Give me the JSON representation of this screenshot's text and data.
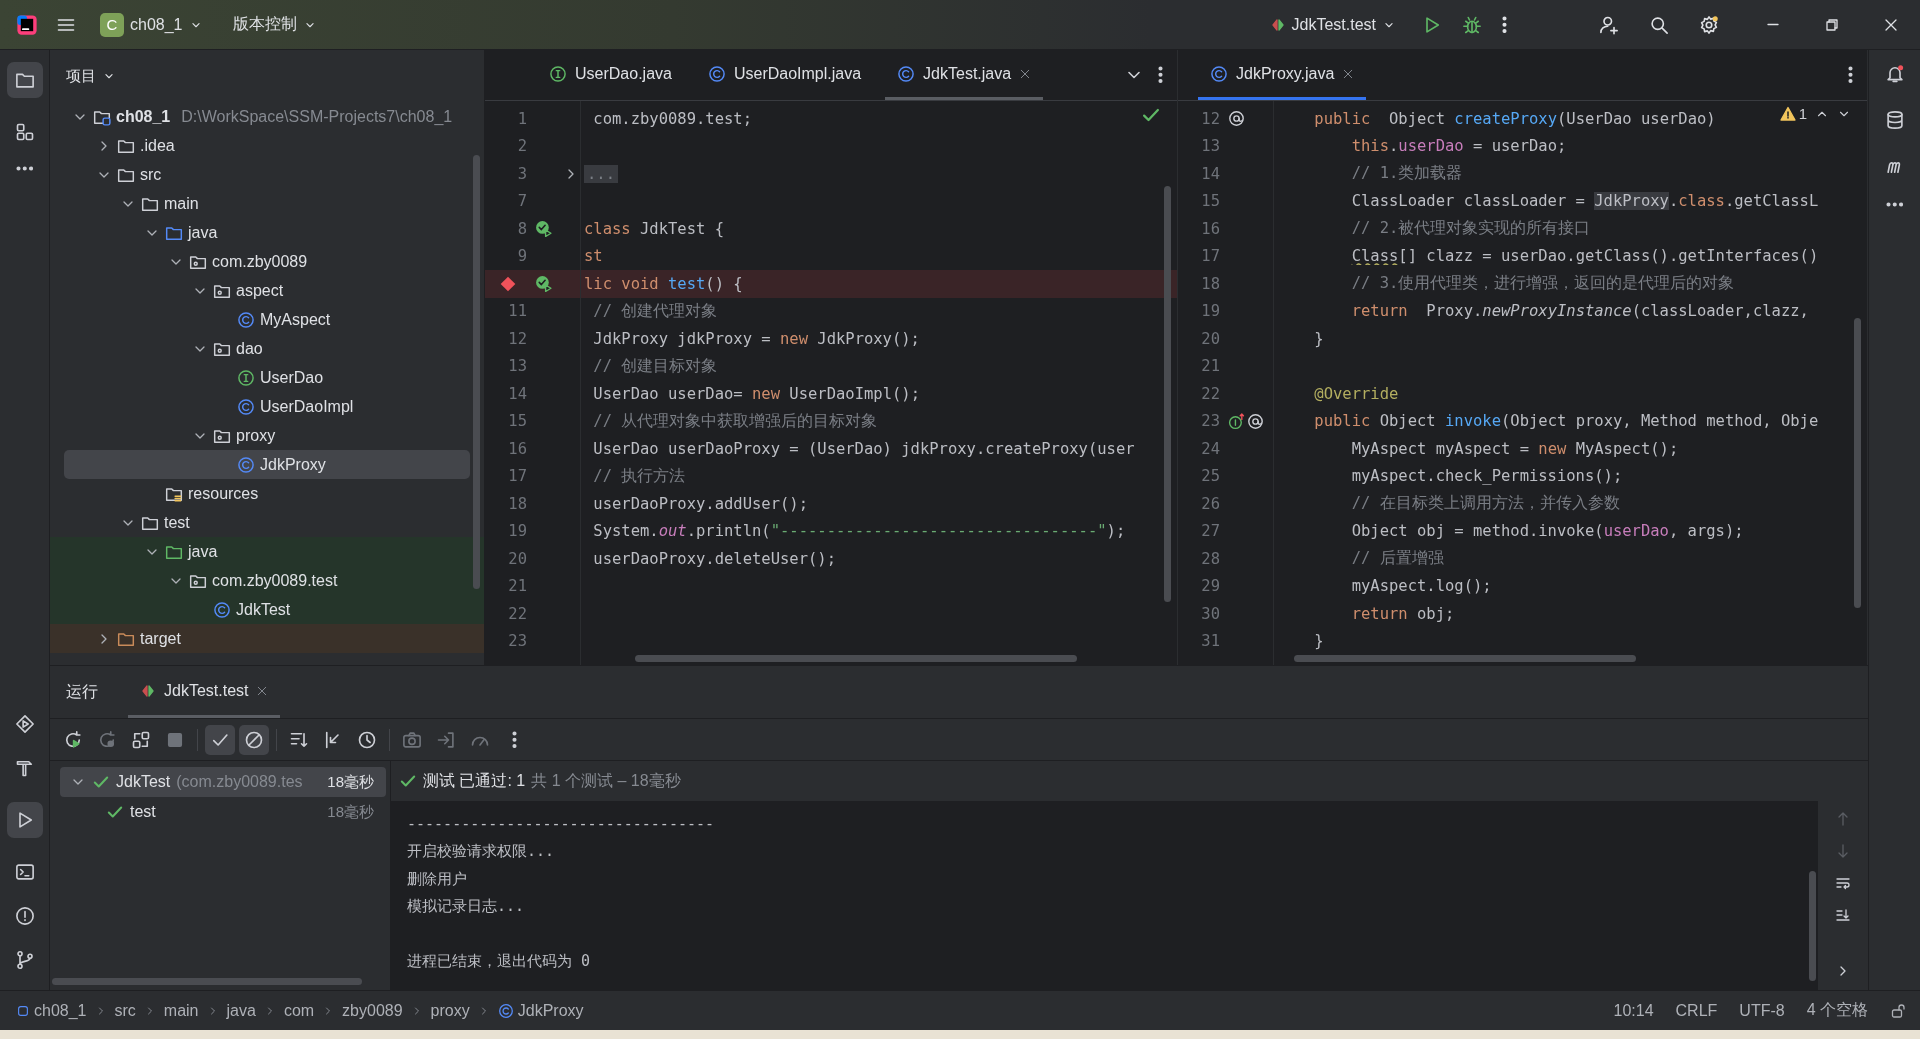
{
  "title_bar": {
    "project_badge": "C",
    "project": "ch08_1",
    "vcs": "版本控制",
    "run_config": "JdkTest.test"
  },
  "project_panel": {
    "title": "项目",
    "tree": [
      {
        "label": "ch08_1",
        "kind": "module",
        "path": "D:\\WorkSpace\\SSM-Projects7\\ch08_1",
        "expanded": true,
        "selected": false,
        "children": [
          {
            "label": ".idea",
            "kind": "folder",
            "expanded": false,
            "selected": false
          },
          {
            "label": "src",
            "kind": "folder",
            "expanded": true,
            "selected": false,
            "children": [
              {
                "label": "main",
                "kind": "folder",
                "expanded": true,
                "selected": false,
                "children": [
                  {
                    "label": "java",
                    "kind": "source-folder",
                    "expanded": true,
                    "selected": false,
                    "children": [
                      {
                        "label": "com.zby0089",
                        "kind": "package",
                        "expanded": true,
                        "selected": false,
                        "children": [
                          {
                            "label": "aspect",
                            "kind": "package",
                            "expanded": true,
                            "selected": false,
                            "children": [
                              {
                                "label": "MyAspect",
                                "kind": "class",
                                "selected": false
                              }
                            ]
                          },
                          {
                            "label": "dao",
                            "kind": "package",
                            "expanded": true,
                            "selected": false,
                            "children": [
                              {
                                "label": "UserDao",
                                "kind": "interface",
                                "selected": false
                              },
                              {
                                "label": "UserDaoImpl",
                                "kind": "class",
                                "selected": false
                              }
                            ]
                          },
                          {
                            "label": "proxy",
                            "kind": "package",
                            "expanded": true,
                            "selected": false,
                            "children": [
                              {
                                "label": "JdkProxy",
                                "kind": "class",
                                "selected": true
                              }
                            ]
                          }
                        ]
                      }
                    ]
                  },
                  {
                    "label": "resources",
                    "kind": "resources",
                    "selected": false
                  }
                ]
              },
              {
                "label": "test",
                "kind": "folder",
                "expanded": true,
                "selected": false,
                "children": [
                  {
                    "label": "java",
                    "kind": "test-folder",
                    "test_scope": true,
                    "expanded": true,
                    "selected": false,
                    "children": [
                      {
                        "label": "com.zby0089.test",
                        "kind": "package",
                        "test_scope": true,
                        "expanded": true,
                        "selected": false,
                        "children": [
                          {
                            "label": "JdkTest",
                            "kind": "class",
                            "test_scope": true,
                            "selected": false
                          }
                        ]
                      }
                    ]
                  }
                ]
              }
            ]
          },
          {
            "label": "target",
            "kind": "excluded-folder",
            "excluded": true,
            "expanded": false,
            "selected": false
          }
        ]
      }
    ]
  },
  "editors": [
    {
      "focused": false,
      "inspection": {
        "kind": "ok"
      },
      "tabs": [
        {
          "label": "UserDao.java",
          "kind": "interface",
          "selected": false
        },
        {
          "label": "UserDaoImpl.java",
          "kind": "class",
          "selected": false
        },
        {
          "label": "JdkTest.java",
          "kind": "class",
          "selected": true,
          "closable": true
        }
      ],
      "lines": [
        {
          "number": "1",
          "tokens": [
            {
              "kind": "plain",
              "text": " com.zby0089.test;"
            }
          ]
        },
        {
          "number": "2"
        },
        {
          "number": "3",
          "folded": true,
          "tokens": [
            {
              "kind": "fold",
              "text": "..."
            }
          ]
        },
        {
          "number": "7"
        },
        {
          "number": "8",
          "run_marker": true,
          "tokens": [
            {
              "kind": "keyword",
              "text": "class"
            },
            {
              "kind": "plain",
              "text": " JdkTest {"
            }
          ]
        },
        {
          "number": "9",
          "tokens": [
            {
              "kind": "keyword",
              "text": "st"
            }
          ]
        },
        {
          "breakpoint": true,
          "run_marker": true,
          "tokens": [
            {
              "kind": "keyword",
              "text": "lic void "
            },
            {
              "kind": "method",
              "text": "test"
            },
            {
              "kind": "plain",
              "text": "() {"
            }
          ]
        },
        {
          "number": "11",
          "tokens": [
            {
              "kind": "comment",
              "text": " // 创建代理对象"
            }
          ]
        },
        {
          "number": "12",
          "tokens": [
            {
              "kind": "plain",
              "text": " JdkProxy jdkProxy = "
            },
            {
              "kind": "keyword",
              "text": "new"
            },
            {
              "kind": "plain",
              "text": " JdkProxy();"
            }
          ]
        },
        {
          "number": "13",
          "tokens": [
            {
              "kind": "comment",
              "text": " // 创建目标对象"
            }
          ]
        },
        {
          "number": "14",
          "tokens": [
            {
              "kind": "plain",
              "text": " UserDao userDao= "
            },
            {
              "kind": "keyword",
              "text": "new"
            },
            {
              "kind": "plain",
              "text": " UserDaoImpl();"
            }
          ]
        },
        {
          "number": "15",
          "tokens": [
            {
              "kind": "comment",
              "text": " // 从代理对象中获取增强后的目标对象"
            }
          ]
        },
        {
          "number": "16",
          "tokens": [
            {
              "kind": "plain",
              "text": " UserDao userDaoProxy = (UserDao) jdkProxy.createProxy(user"
            }
          ]
        },
        {
          "number": "17",
          "tokens": [
            {
              "kind": "comment",
              "text": " // 执行方法"
            }
          ]
        },
        {
          "number": "18",
          "tokens": [
            {
              "kind": "plain",
              "text": " userDaoProxy.addUser();"
            }
          ]
        },
        {
          "number": "19",
          "tokens": [
            {
              "kind": "plain",
              "text": " System."
            },
            {
              "kind": "static-field",
              "text": "out"
            },
            {
              "kind": "plain",
              "text": ".println("
            },
            {
              "kind": "string",
              "text": "\"----------------------------------\""
            },
            {
              "kind": "plain",
              "text": ");"
            }
          ]
        },
        {
          "number": "20",
          "tokens": [
            {
              "kind": "plain",
              "text": " userDaoProxy.deleteUser();"
            }
          ]
        },
        {
          "number": "21"
        },
        {
          "number": "22"
        },
        {
          "number": "23"
        }
      ]
    },
    {
      "focused": true,
      "inspection": {
        "kind": "warnings",
        "count": "1"
      },
      "tabs": [
        {
          "label": "JdkProxy.java",
          "kind": "class",
          "selected": true,
          "closable": true
        }
      ],
      "lines": [
        {
          "number": "12",
          "implementation_marker": true,
          "tokens": [
            {
              "kind": "keyword",
              "text": "    public"
            },
            {
              "kind": "plain",
              "text": "  Object "
            },
            {
              "kind": "method",
              "text": "createProxy"
            },
            {
              "kind": "plain",
              "text": "(UserDao userDao)"
            }
          ]
        },
        {
          "number": "13",
          "tokens": [
            {
              "kind": "keyword",
              "text": "        this"
            },
            {
              "kind": "plain",
              "text": "."
            },
            {
              "kind": "field",
              "text": "userDao"
            },
            {
              "kind": "plain",
              "text": " = userDao;"
            }
          ]
        },
        {
          "number": "14",
          "tokens": [
            {
              "kind": "comment",
              "text": "        // 1.类加载器"
            }
          ]
        },
        {
          "number": "15",
          "tokens": [
            {
              "kind": "plain",
              "text": "        ClassLoader classLoader = "
            },
            {
              "kind": "highlight",
              "text": "JdkProxy"
            },
            {
              "kind": "plain",
              "text": "."
            },
            {
              "kind": "keyword",
              "text": "class"
            },
            {
              "kind": "plain",
              "text": ".getClassL"
            }
          ]
        },
        {
          "number": "16",
          "tokens": [
            {
              "kind": "comment",
              "text": "        // 2.被代理对象实现的所有接口"
            }
          ]
        },
        {
          "number": "17",
          "tokens": [
            {
              "kind": "squiggle",
              "text": "        Class"
            },
            {
              "kind": "plain",
              "text": "[] clazz = userDao.getClass().getInterfaces()"
            }
          ]
        },
        {
          "number": "18",
          "tokens": [
            {
              "kind": "comment",
              "text": "        // 3.使用代理类，进行增强，返回的是代理后的对象"
            }
          ]
        },
        {
          "number": "19",
          "tokens": [
            {
              "kind": "keyword",
              "text": "        return"
            },
            {
              "kind": "plain",
              "text": "  Proxy."
            },
            {
              "kind": "static-call",
              "text": "newProxyInstance"
            },
            {
              "kind": "plain",
              "text": "(classLoader,clazz,"
            }
          ]
        },
        {
          "number": "20",
          "tokens": [
            {
              "kind": "plain",
              "text": "    }"
            }
          ]
        },
        {
          "number": "21"
        },
        {
          "number": "22",
          "tokens": [
            {
              "kind": "annotation",
              "text": "    @Override"
            }
          ]
        },
        {
          "number": "23",
          "override_marker": true,
          "implementation_marker": true,
          "tokens": [
            {
              "kind": "keyword",
              "text": "    public"
            },
            {
              "kind": "plain",
              "text": " Object "
            },
            {
              "kind": "method",
              "text": "invoke"
            },
            {
              "kind": "plain",
              "text": "(Object proxy, Method method, Obje"
            }
          ]
        },
        {
          "number": "24",
          "tokens": [
            {
              "kind": "plain",
              "text": "        MyAspect myAspect = "
            },
            {
              "kind": "keyword",
              "text": "new"
            },
            {
              "kind": "plain",
              "text": " MyAspect();"
            }
          ]
        },
        {
          "number": "25",
          "tokens": [
            {
              "kind": "plain",
              "text": "        myAspect.check_Permissions();"
            }
          ]
        },
        {
          "number": "26",
          "tokens": [
            {
              "kind": "comment",
              "text": "        // 在目标类上调用方法，并传入参数"
            }
          ]
        },
        {
          "number": "27",
          "tokens": [
            {
              "kind": "plain",
              "text": "        Object obj = method.invoke("
            },
            {
              "kind": "field",
              "text": "userDao"
            },
            {
              "kind": "plain",
              "text": ", args);"
            }
          ]
        },
        {
          "number": "28",
          "tokens": [
            {
              "kind": "comment",
              "text": "        // 后置增强"
            }
          ]
        },
        {
          "number": "29",
          "tokens": [
            {
              "kind": "plain",
              "text": "        myAspect.log();"
            }
          ]
        },
        {
          "number": "30",
          "tokens": [
            {
              "kind": "keyword",
              "text": "        return"
            },
            {
              "kind": "plain",
              "text": " obj;"
            }
          ]
        },
        {
          "number": "31",
          "tokens": [
            {
              "kind": "plain",
              "text": "    }"
            }
          ]
        }
      ]
    }
  ],
  "run_panel": {
    "title": "运行",
    "tabs": [
      {
        "label": "JdkTest.test",
        "selected": true,
        "closable": true
      }
    ],
    "toolbar": [
      {
        "kind": "rerun"
      },
      {
        "kind": "rerun-failed",
        "disabled": true
      },
      {
        "kind": "toggle-auto"
      },
      {
        "kind": "stop",
        "disabled": true
      },
      {
        "kind": "show-passed",
        "on": true
      },
      {
        "kind": "show-ignored",
        "on": true
      },
      {
        "kind": "sort"
      },
      {
        "kind": "collapse"
      },
      {
        "kind": "history"
      },
      {
        "kind": "camera",
        "disabled": true
      },
      {
        "kind": "export",
        "disabled": true
      },
      {
        "kind": "gauge",
        "disabled": true
      },
      {
        "kind": "more"
      }
    ],
    "tests": [
      {
        "label": "JdkTest",
        "detail": "(com.zby0089.tes",
        "time": "18毫秒",
        "passed": true,
        "expanded": true,
        "selected": true,
        "children": [
          {
            "label": "test",
            "time": "18毫秒",
            "passed": true,
            "selected": false
          }
        ]
      }
    ],
    "summary": {
      "passed": true,
      "status": "测试 已通过: 1",
      "detail": "共 1 个测试 – 18毫秒"
    },
    "console": [
      {
        "text": "----------------------------------"
      },
      {
        "text": "开启校验请求权限..."
      },
      {
        "text": "删除用户"
      },
      {
        "text": "模拟记录日志..."
      },
      {
        "text": "进程已结束，退出代码为 0",
        "gap_before": true
      }
    ]
  },
  "breadcrumbs": [
    {
      "label": "ch08_1",
      "kind": "module"
    },
    {
      "label": "src",
      "kind": "folder"
    },
    {
      "label": "main",
      "kind": "folder"
    },
    {
      "label": "java",
      "kind": "folder"
    },
    {
      "label": "com",
      "kind": "folder"
    },
    {
      "label": "zby0089",
      "kind": "folder"
    },
    {
      "label": "proxy",
      "kind": "folder"
    },
    {
      "label": "JdkProxy",
      "kind": "class"
    }
  ],
  "status_bar": [
    "10:14",
    "CRLF",
    "UTF-8",
    "4 个空格"
  ]
}
